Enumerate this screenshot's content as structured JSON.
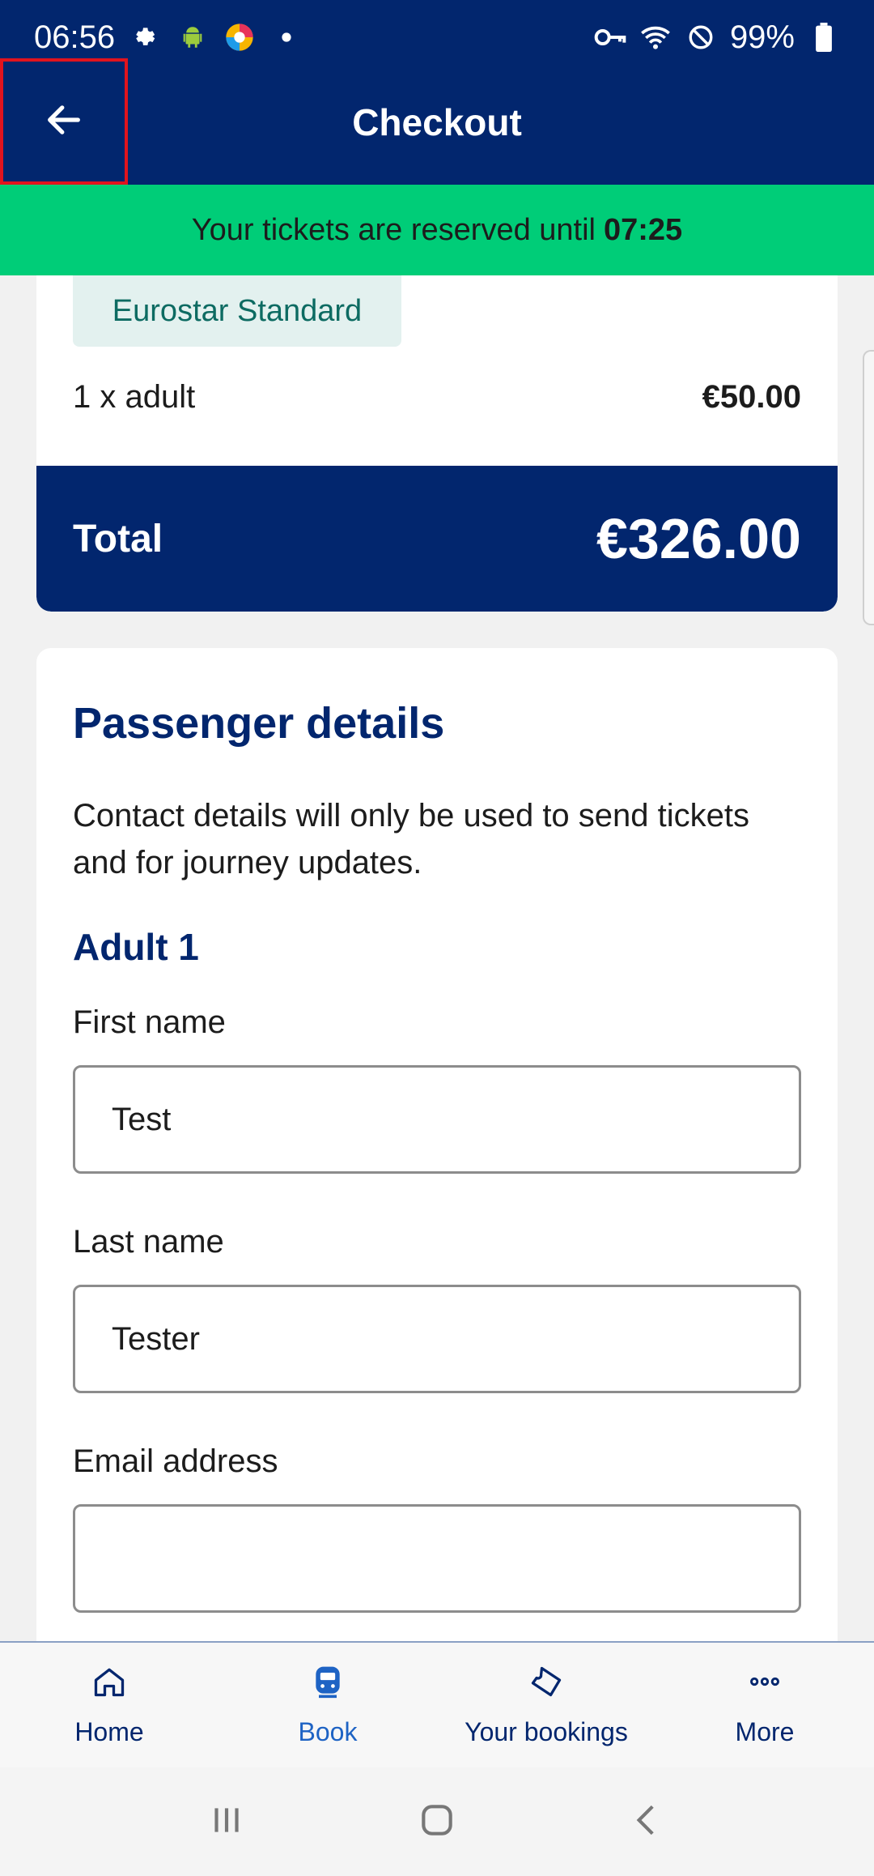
{
  "status_bar": {
    "time": "06:56",
    "battery": "99%",
    "icons": [
      "gear-icon",
      "android-icon",
      "browser-icon",
      "dot-icon",
      "key-icon",
      "wifi-icon",
      "no-disturb-icon",
      "battery-icon"
    ]
  },
  "header": {
    "title": "Checkout",
    "back_icon": "arrow-left-icon"
  },
  "timer": {
    "text": "Your tickets are reserved until",
    "time": "07:25"
  },
  "fare": {
    "class_name": "Eurostar Standard",
    "passenger_line": "1 x adult",
    "passenger_price": "€50.00",
    "total_label": "Total",
    "total_value": "€326.00"
  },
  "passenger_details": {
    "title": "Passenger details",
    "description": "Contact details will only be used to send tickets and for journey updates.",
    "passenger_heading": "Adult 1",
    "fields": [
      {
        "label": "First name",
        "value": "Test"
      },
      {
        "label": "Last name",
        "value": "Tester"
      },
      {
        "label": "Email address",
        "value": ""
      }
    ]
  },
  "bottom_nav": {
    "items": [
      {
        "label": "Home",
        "icon": "home-icon",
        "active": false
      },
      {
        "label": "Book",
        "icon": "train-icon",
        "active": true
      },
      {
        "label": "Your bookings",
        "icon": "ticket-icon",
        "active": false
      },
      {
        "label": "More",
        "icon": "more-dots-icon",
        "active": false
      }
    ]
  },
  "colors": {
    "brand_navy": "#02266e",
    "timer_green": "#00cd78",
    "active_blue": "#1e63c4",
    "badge_bg": "#e3f1ef",
    "badge_text": "#0d6b62"
  }
}
